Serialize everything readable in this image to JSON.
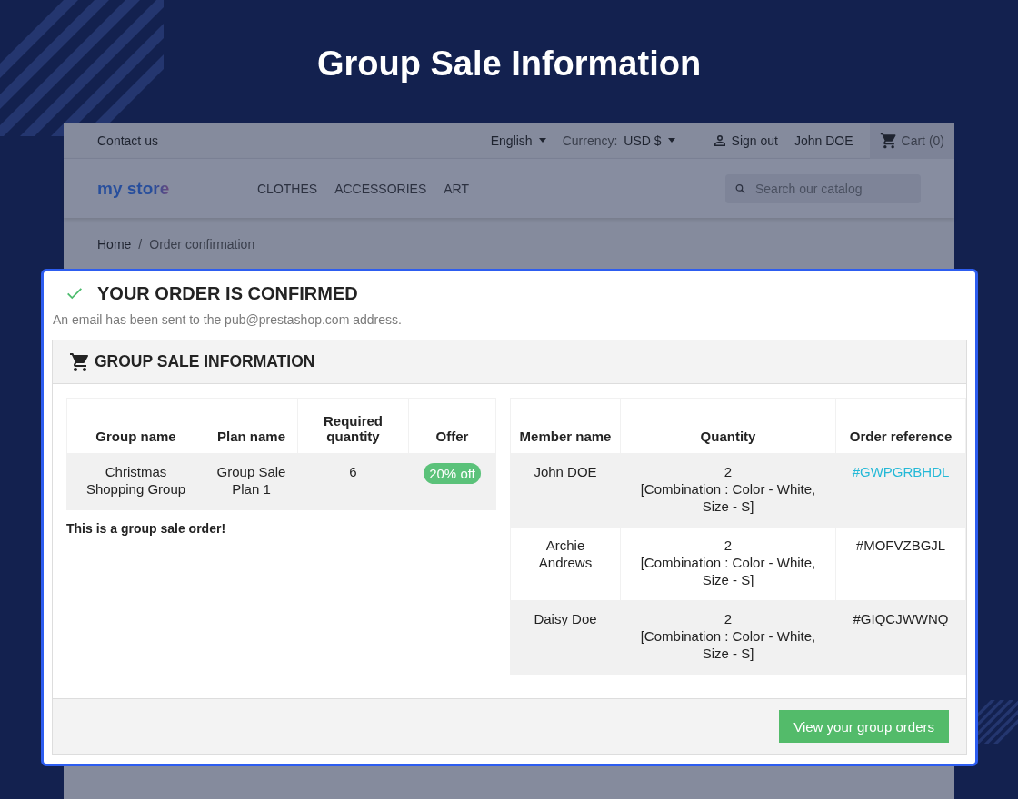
{
  "page_title": "Group Sale Information",
  "store": {
    "top_bar": {
      "contact": "Contact us",
      "language": "English",
      "currency_label": "Currency:",
      "currency": "USD $",
      "sign_out": "Sign out",
      "user": "John DOE",
      "cart": "Cart (0)"
    },
    "logo": "my store",
    "nav": [
      "CLOTHES",
      "ACCESSORIES",
      "ART"
    ],
    "search": {
      "placeholder": "Search our catalog"
    },
    "breadcrumb": {
      "items": [
        "Home",
        "Order confirmation"
      ],
      "separator": "/"
    }
  },
  "confirmation": {
    "title": "YOUR ORDER IS CONFIRMED",
    "message": "An email has been sent to the pub@prestashop.com address.",
    "panel": {
      "title": "GROUP SALE INFORMATION",
      "group_table": {
        "columns": [
          "Group name",
          "Plan name",
          "Required quantity",
          "Offer"
        ],
        "rows": [
          {
            "group_name": "Christmas Shopping Group",
            "plan_name": "Group Sale Plan 1",
            "required_quantity": "6",
            "offer": "20% off"
          }
        ]
      },
      "note": "This is a group sale order!",
      "member_table": {
        "columns": [
          "Member name",
          "Quantity",
          "Order reference"
        ],
        "rows": [
          {
            "member_name": "John DOE",
            "quantity": "2",
            "combination": "[Combination : Color - White, Size - S]",
            "order_reference": "#GWPGRBHDL",
            "linked": true
          },
          {
            "member_name": "Archie Andrews",
            "quantity": "2",
            "combination": "[Combination : Color - White, Size - S]",
            "order_reference": "#MOFVZBGJL",
            "linked": false
          },
          {
            "member_name": "Daisy Doe",
            "quantity": "2",
            "combination": "[Combination : Color - White, Size - S]",
            "order_reference": "#GIQCJWWNQ",
            "linked": false
          }
        ]
      },
      "button": "View your group orders"
    }
  }
}
